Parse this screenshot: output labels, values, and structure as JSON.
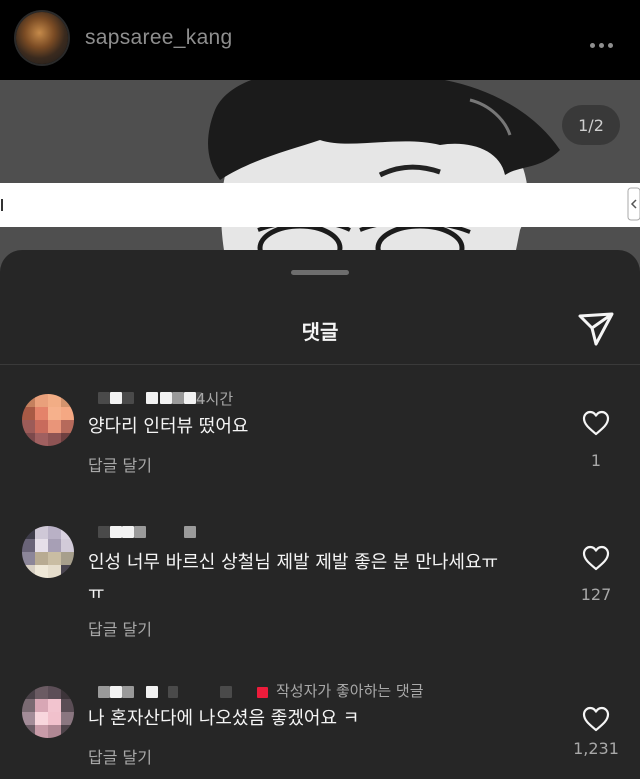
{
  "header": {
    "username": "sapsaree_kang",
    "more_icon": "more-horizontal-icon"
  },
  "post": {
    "page_indicator": "1/2"
  },
  "sheet": {
    "title": "댓글",
    "share_icon": "send-icon"
  },
  "comments": [
    {
      "time": "4시간",
      "text": "양다리 인터뷰 떴어요",
      "reply_label": "답글 달기",
      "likes": "1"
    },
    {
      "text": "인성 너무 바르신 상철님 제발 제발 좋은 분 만나세요ㅠ",
      "text_line2": "ㅠ",
      "reply_label": "답글 달기",
      "likes": "127"
    },
    {
      "badge": "작성자가 좋아하는 댓글",
      "text": "나 혼자산다에 나오셨음 좋겠어요 ㅋ",
      "reply_label": "답글 달기",
      "likes": "1,231"
    }
  ],
  "colors": {
    "background": "#262626",
    "header": "#000000",
    "creator_dot": "#ed1c3b",
    "secondary_text": "#a8a8a8"
  }
}
